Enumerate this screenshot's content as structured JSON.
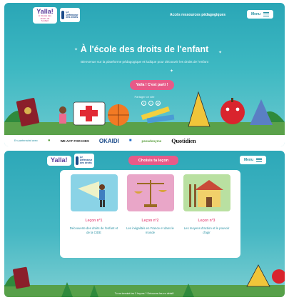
{
  "header": {
    "logo_main": "Yalla!",
    "logo_sub": "À l'école des droits de l'enfant",
    "logo_partner": "Le Défenseur des droits",
    "resources_link": "Accès ressources pédagogiques",
    "menu_label": "Menu"
  },
  "hero": {
    "title": "À l'école des droits de l'enfant",
    "subtitle": "Bienvenue sur la plateforme pédagogique et ludique pour découvrir les droits de l'enfant",
    "cta_label": "Yalla ! C'est parti !",
    "share_label": "Partager ce site",
    "share_icons": [
      "facebook-icon",
      "twitter-icon",
      "mail-icon"
    ]
  },
  "partners": {
    "label": "En partenariat avec",
    "logos": [
      "WE ACT FOR KIDS",
      "OKAIDI",
      "pseudonyme",
      "Quotidien"
    ]
  },
  "section2": {
    "title": "Choisis ta leçon",
    "menu_label": "Menu",
    "lessons": [
      {
        "number": "Leçon n°1",
        "description": "Découverte des droits de l'enfant et de la CIDE",
        "color": "#8ad3e6"
      },
      {
        "number": "Leçon n°2",
        "description": "Les inégalités en France et dans le monde",
        "color": "#e9a6c8"
      },
      {
        "number": "Leçon n°3",
        "description": "Les moyens d'action et le pouvoir d'agir",
        "color": "#b9e0a1"
      }
    ],
    "scroll_note": "Tu as terminé les 3 leçons ? Découvre-les en détail !"
  },
  "colors": {
    "teal": "#2aa6b6",
    "pink": "#e85a88",
    "white": "#ffffff"
  }
}
